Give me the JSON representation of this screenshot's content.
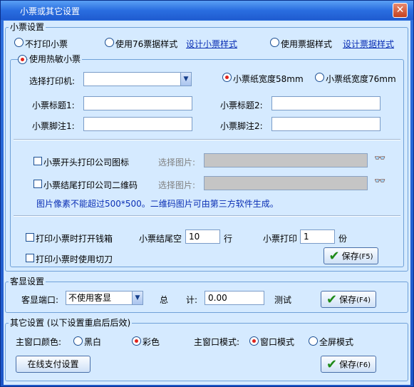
{
  "window": {
    "title": "小票或其它设置",
    "close_icon": "close-icon"
  },
  "receipt": {
    "group_label": "小票设置",
    "no_print": "不打印小票",
    "use76": "使用76票据样式",
    "design_receipt": "设计小票样式",
    "use_ticket": "使用票据样式",
    "design_ticket": "设计票据样式",
    "thermal": {
      "group_label": "使用热敏小票",
      "select_printer_label": "选择打印机:",
      "printer_value": "",
      "width58": "小票纸宽度58mm",
      "width76": "小票纸宽度76mm",
      "title1_label": "小票标题1:",
      "title1_value": "",
      "title2_label": "小票标题2:",
      "title2_value": "",
      "footer1_label": "小票脚注1:",
      "footer1_value": "",
      "footer2_label": "小票脚注2:",
      "footer2_value": "",
      "header_logo": "小票开头打印公司图标",
      "select_image1": "选择图片:",
      "footer_qr": "小票结尾打印公司二维码",
      "select_image2": "选择图片:",
      "note": "图片像素不能超过500*500。二维码图片可由第三方软件生成。",
      "open_drawer": "打印小票时打开钱箱",
      "use_cutter": "打印小票时使用切刀",
      "tail_space_label": "小票结尾空",
      "tail_space_value": "10",
      "tail_space_unit": "行",
      "print_label": "小票打印",
      "print_value": "1",
      "print_unit": "份",
      "save": "保存",
      "save_key": "(F5)"
    }
  },
  "display": {
    "group_label": "客显设置",
    "port_label": "客显端口:",
    "port_value": "不使用客显",
    "total_label1": "总",
    "total_label2": "计:",
    "total_value": "0.00",
    "test": "测试",
    "save": "保存",
    "save_key": "(F4)"
  },
  "other": {
    "group_label": "其它设置 (以下设置重启后后效)",
    "color_label": "主窗口颜色:",
    "bw": "黑白",
    "color": "彩色",
    "mode_label": "主窗口模式:",
    "window_mode": "窗口模式",
    "fullscreen": "全屏模式",
    "online_pay": "在线支付设置",
    "save": "保存",
    "save_key": "(F6)"
  }
}
